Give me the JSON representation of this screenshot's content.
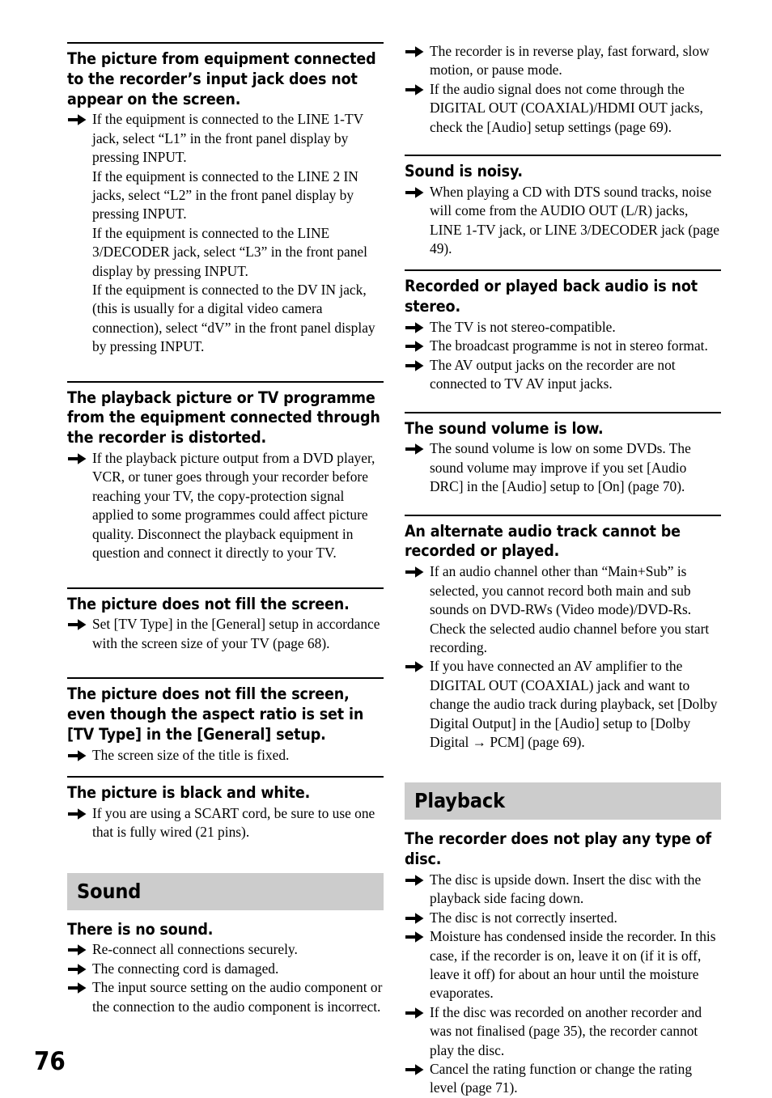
{
  "page": {
    "number": "76",
    "icons": {
      "bullet": "arrow-right-icon"
    }
  },
  "left_column": {
    "entries": [
      {
        "title": "The picture from equipment connected to the recorder’s input jack does not appear on the screen.",
        "tips": [
          "If the equipment is connected to the LINE 1-TV jack, select “L1” in the front panel display by pressing INPUT.|If the equipment is connected to the LINE 2 IN jacks, select “L2” in the front panel display by pressing INPUT.|If the equipment is connected to the LINE 3/DECODER jack, select “L3” in the front panel display by pressing INPUT.|If the equipment is connected to the DV IN jack, (this is usually for a digital video camera connection), select “dV” in the front panel display by pressing INPUT."
        ]
      },
      {
        "title": "The playback picture or TV programme from the equipment connected through the recorder is distorted.",
        "tips": [
          "If the playback picture output from a DVD player, VCR, or tuner goes through your recorder before reaching your TV, the copy-protection signal applied to some programmes could affect picture quality. Disconnect the playback equipment in question and connect it directly to your TV."
        ]
      },
      {
        "title": "The picture does not fill the screen.",
        "tips": [
          "Set [TV Type] in the [General] setup in accordance with the screen size of your TV (page 68)."
        ]
      },
      {
        "title": "The picture does not fill the screen, even though the aspect ratio is set in [TV Type] in the [General] setup.",
        "tips": [
          "The screen size of the title is fixed."
        ]
      },
      {
        "title": "The picture is black and white.",
        "tips": [
          "If you are using a SCART cord, be sure to use one that is fully wired (21 pins)."
        ]
      }
    ],
    "section_band": "Sound",
    "after_band_entries": [
      {
        "title": "There is no sound.",
        "tips": [
          "Re-connect all connections securely.",
          "The connecting cord is damaged.",
          "The input source setting on the audio component or the connection to the audio component is incorrect."
        ]
      }
    ]
  },
  "right_column": {
    "continued_tips": [
      "The recorder is in reverse play, fast forward, slow motion, or pause mode.",
      "If the audio signal does not come through the DIGITAL OUT (COAXIAL)/HDMI OUT jacks, check the [Audio] setup settings (page 69)."
    ],
    "entries": [
      {
        "title": "Sound is noisy.",
        "tips": [
          "When playing a CD with DTS sound tracks, noise will come from the AUDIO OUT (L/R) jacks, LINE 1-TV jack, or LINE 3/DECODER jack (page 49)."
        ]
      },
      {
        "title": "Recorded or played back audio is not stereo.",
        "tips": [
          "The TV is not stereo-compatible.",
          "The broadcast programme is not in stereo format.",
          "The AV output jacks on the recorder are not connected to TV AV input jacks."
        ]
      },
      {
        "title": "The sound volume is low.",
        "tips": [
          "The sound volume is low on some DVDs. The sound volume may improve if you set [Audio DRC] in the [Audio] setup to [On] (page 70)."
        ]
      },
      {
        "title": "An alternate audio track cannot be recorded or played.",
        "tips": [
          "If an audio channel other than “Main+Sub” is selected, you cannot record both main and sub sounds on DVD-RWs (Video mode)/DVD-Rs. Check the selected audio channel before you start recording.",
          "If you have connected an AV amplifier to the DIGITAL OUT (COAXIAL) jack and want to change the audio track during playback, set [Dolby Digital Output] in the [Audio] setup to [Dolby Digital → PCM] (page 69)."
        ]
      }
    ],
    "section_band": "Playback",
    "after_band_entries": [
      {
        "title": "The recorder does not play any type of disc.",
        "tips": [
          "The disc is upside down. Insert the disc with the playback side facing down.",
          "The disc is not correctly inserted.",
          "Moisture has condensed inside the recorder. In this case, if the recorder is on, leave it on (if it is off, leave it off) for about an hour until the moisture evaporates.",
          "If the disc was recorded on another recorder and was not finalised (page 35), the recorder cannot play the disc.",
          "Cancel the rating function or change the rating level (page 71)."
        ]
      }
    ]
  }
}
